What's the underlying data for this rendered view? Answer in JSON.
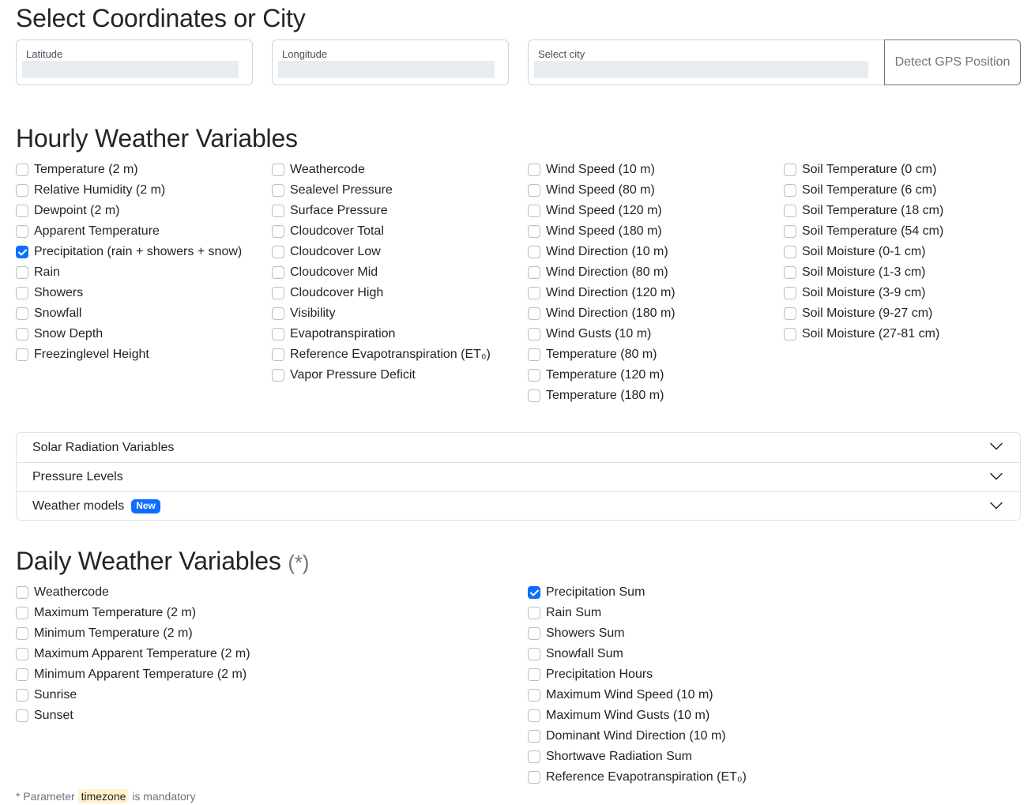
{
  "coordinates": {
    "heading": "Select Coordinates or City",
    "latitude_label": "Latitude",
    "latitude_value": "",
    "longitude_label": "Longitude",
    "longitude_value": "",
    "city_label": "Select city",
    "city_value": "",
    "gps_button": "Detect GPS Position"
  },
  "hourly": {
    "heading": "Hourly Weather Variables",
    "columns": [
      [
        {
          "label": "Temperature (2 m)",
          "checked": false
        },
        {
          "label": "Relative Humidity (2 m)",
          "checked": false
        },
        {
          "label": "Dewpoint (2 m)",
          "checked": false
        },
        {
          "label": "Apparent Temperature",
          "checked": false
        },
        {
          "label": "Precipitation (rain + showers + snow)",
          "checked": true
        },
        {
          "label": "Rain",
          "checked": false
        },
        {
          "label": "Showers",
          "checked": false
        },
        {
          "label": "Snowfall",
          "checked": false
        },
        {
          "label": "Snow Depth",
          "checked": false
        },
        {
          "label": "Freezinglevel Height",
          "checked": false
        }
      ],
      [
        {
          "label": "Weathercode",
          "checked": false
        },
        {
          "label": "Sealevel Pressure",
          "checked": false
        },
        {
          "label": "Surface Pressure",
          "checked": false
        },
        {
          "label": "Cloudcover Total",
          "checked": false
        },
        {
          "label": "Cloudcover Low",
          "checked": false
        },
        {
          "label": "Cloudcover Mid",
          "checked": false
        },
        {
          "label": "Cloudcover High",
          "checked": false
        },
        {
          "label": "Visibility",
          "checked": false
        },
        {
          "label": "Evapotranspiration",
          "checked": false
        },
        {
          "label": "Reference Evapotranspiration (ET₀)",
          "checked": false
        },
        {
          "label": "Vapor Pressure Deficit",
          "checked": false
        }
      ],
      [
        {
          "label": "Wind Speed (10 m)",
          "checked": false
        },
        {
          "label": "Wind Speed (80 m)",
          "checked": false
        },
        {
          "label": "Wind Speed (120 m)",
          "checked": false
        },
        {
          "label": "Wind Speed (180 m)",
          "checked": false
        },
        {
          "label": "Wind Direction (10 m)",
          "checked": false
        },
        {
          "label": "Wind Direction (80 m)",
          "checked": false
        },
        {
          "label": "Wind Direction (120 m)",
          "checked": false
        },
        {
          "label": "Wind Direction (180 m)",
          "checked": false
        },
        {
          "label": "Wind Gusts (10 m)",
          "checked": false
        },
        {
          "label": "Temperature (80 m)",
          "checked": false
        },
        {
          "label": "Temperature (120 m)",
          "checked": false
        },
        {
          "label": "Temperature (180 m)",
          "checked": false
        }
      ],
      [
        {
          "label": "Soil Temperature (0 cm)",
          "checked": false
        },
        {
          "label": "Soil Temperature (6 cm)",
          "checked": false
        },
        {
          "label": "Soil Temperature (18 cm)",
          "checked": false
        },
        {
          "label": "Soil Temperature (54 cm)",
          "checked": false
        },
        {
          "label": "Soil Moisture (0-1 cm)",
          "checked": false
        },
        {
          "label": "Soil Moisture (1-3 cm)",
          "checked": false
        },
        {
          "label": "Soil Moisture (3-9 cm)",
          "checked": false
        },
        {
          "label": "Soil Moisture (9-27 cm)",
          "checked": false
        },
        {
          "label": "Soil Moisture (27-81 cm)",
          "checked": false
        }
      ]
    ]
  },
  "accordion": {
    "solar": "Solar Radiation Variables",
    "pressure": "Pressure Levels",
    "models": "Weather models",
    "models_badge": "New"
  },
  "daily": {
    "heading": "Daily Weather Variables",
    "heading_suffix": "(*)",
    "columns": [
      [
        {
          "label": "Weathercode",
          "checked": false
        },
        {
          "label": "Maximum Temperature (2 m)",
          "checked": false
        },
        {
          "label": "Minimum Temperature (2 m)",
          "checked": false
        },
        {
          "label": "Maximum Apparent Temperature (2 m)",
          "checked": false
        },
        {
          "label": "Minimum Apparent Temperature (2 m)",
          "checked": false
        },
        {
          "label": "Sunrise",
          "checked": false
        },
        {
          "label": "Sunset",
          "checked": false
        }
      ],
      [
        {
          "label": "Precipitation Sum",
          "checked": true
        },
        {
          "label": "Rain Sum",
          "checked": false
        },
        {
          "label": "Showers Sum",
          "checked": false
        },
        {
          "label": "Snowfall Sum",
          "checked": false
        },
        {
          "label": "Precipitation Hours",
          "checked": false
        },
        {
          "label": "Maximum Wind Speed (10 m)",
          "checked": false
        },
        {
          "label": "Maximum Wind Gusts (10 m)",
          "checked": false
        },
        {
          "label": "Dominant Wind Direction (10 m)",
          "checked": false
        },
        {
          "label": "Shortwave Radiation Sum",
          "checked": false
        },
        {
          "label": "Reference Evapotranspiration (ET₀)",
          "checked": false
        }
      ]
    ]
  },
  "footnote": {
    "prefix": "* Parameter",
    "param": "timezone",
    "suffix": "is mandatory"
  },
  "colors": {
    "accent": "#0d6efd",
    "highlight": "#fff3cd"
  }
}
